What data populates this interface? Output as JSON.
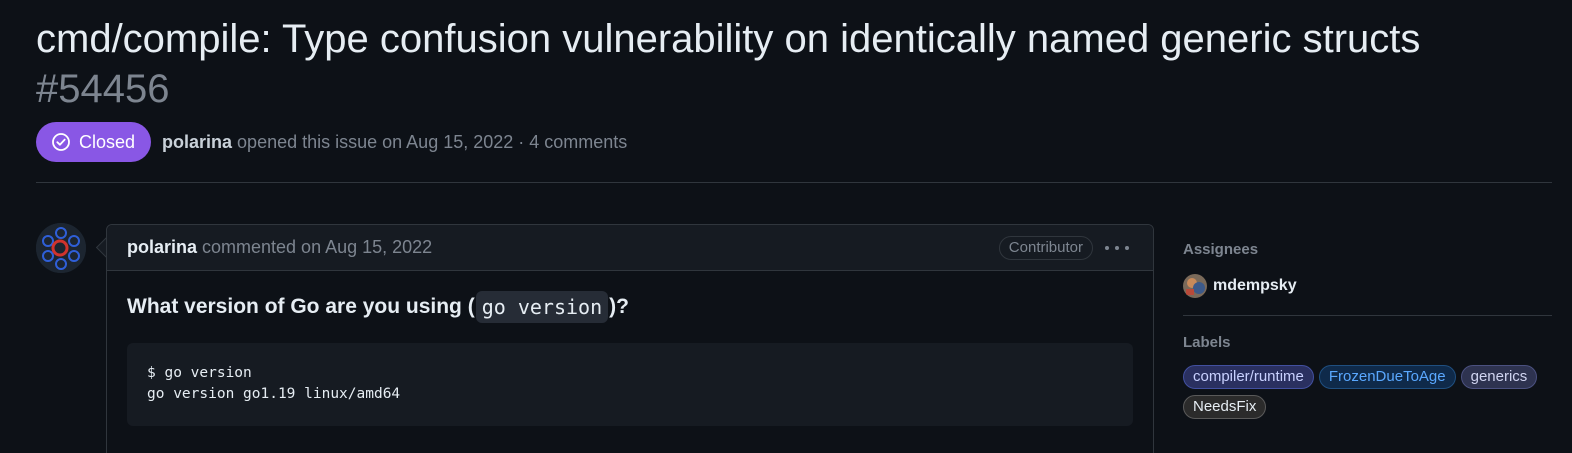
{
  "issue": {
    "title": "cmd/compile: Type confusion vulnerability on identically named generic structs",
    "number": "#54456",
    "state": "Closed",
    "author": "polarina",
    "opened_text": "opened this issue on Aug 15, 2022 · 4 comments"
  },
  "comment": {
    "author": "polarina",
    "meta": "commented on Aug 15, 2022",
    "role": "Contributor",
    "heading_before": "What version of Go are you using (",
    "heading_code": "go version",
    "heading_after": ")?",
    "code_lines": [
      "$ go version",
      "go version go1.19 linux/amd64"
    ]
  },
  "sidebar": {
    "assignees_heading": "Assignees",
    "assignee": "mdempsky",
    "labels_heading": "Labels",
    "labels": [
      {
        "name": "compiler/runtime",
        "color": "#c9d1ff",
        "bg": "#2a3060",
        "border": "#4250a0"
      },
      {
        "name": "FrozenDueToAge",
        "color": "#5aa8ff",
        "bg": "#0f2a4a",
        "border": "#1f4f80"
      },
      {
        "name": "generics",
        "color": "#d0d4f0",
        "bg": "#2e3350",
        "border": "#4b5180"
      },
      {
        "name": "NeedsFix",
        "color": "#e6edf3",
        "bg": "#2b2b2b",
        "border": "#5a5a5a"
      }
    ]
  },
  "colors": {
    "background": "#0d1117",
    "closed_badge": "#8957e5",
    "border": "#30363d",
    "muted": "#7d8590"
  }
}
